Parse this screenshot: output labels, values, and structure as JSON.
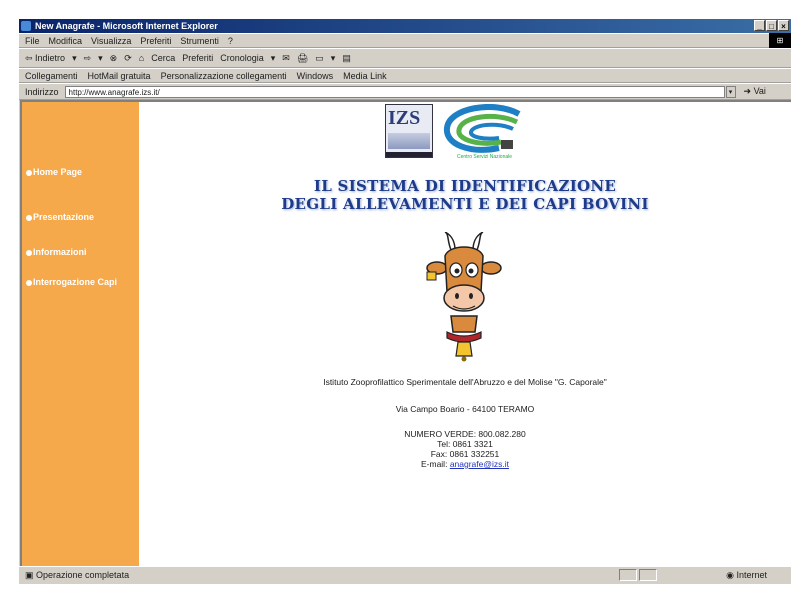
{
  "window": {
    "title": "New Anagrafe - Microsoft Internet Explorer",
    "buttons": [
      "_",
      "□",
      "×"
    ]
  },
  "menu": [
    "File",
    "Modifica",
    "Visualizza",
    "Preferiti",
    "Strumenti",
    "?"
  ],
  "toolbar": [
    "⇦ Indietro",
    "▾",
    "⇨",
    "▾",
    "⊗",
    "⟳",
    "⌂",
    "Cerca",
    "Preferiti",
    "Cronologia",
    "▾",
    "✉",
    "🖨",
    "▭",
    "▾",
    "▤"
  ],
  "links": {
    "label": "Collegamenti",
    "items": [
      "HotMail gratuita",
      "Personalizzazione collegamenti",
      "Windows",
      "Media Link"
    ]
  },
  "address": {
    "label": "Indirizzo",
    "url": "http://www.anagrafe.izs.it/",
    "go": "Vai"
  },
  "sidebar": [
    "Home Page",
    "Presentazione",
    "Informazioni",
    "Interrogazione Capi"
  ],
  "headline": {
    "line1": "IL SISTEMA DI IDENTIFICAZIONE",
    "line2": "DEGLI ALLEVAMENTI E DEI CAPI BOVINI"
  },
  "logo": {
    "izs": "IZS",
    "cs_text": "Centro Servizi Nazionale"
  },
  "info": {
    "institute": "Istituto Zooprofilattico Sperimentale dell'Abruzzo e del Molise \"G. Caporale\"",
    "address": "Via Campo Boario - 64100 TERAMO",
    "phone_free": "NUMERO VERDE: 800.082.280",
    "tel": "Tel: 0861 3321",
    "fax": "Fax: 0861 332251",
    "email_label": "E-mail:",
    "email": "anagrafe@izs.it"
  },
  "status": {
    "text": "Operazione completata",
    "zone": "Internet"
  },
  "colors": {
    "sidebar": "#f6a94b",
    "headline": "#1e3a8a",
    "titlebar": "#0a246a"
  }
}
